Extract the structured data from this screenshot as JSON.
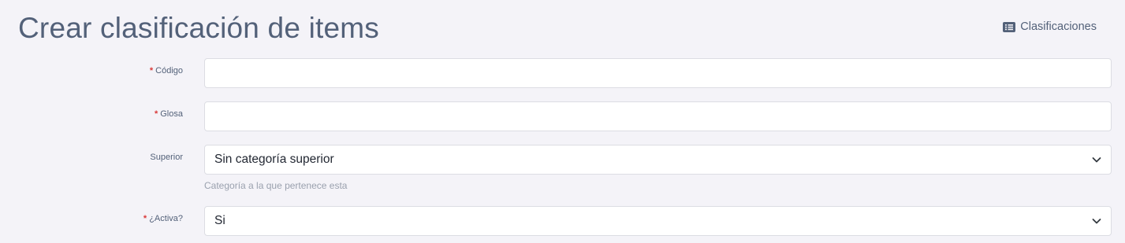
{
  "page": {
    "title": "Crear clasificación de items"
  },
  "header": {
    "link_label": "Clasificaciones",
    "link_icon": "list-icon"
  },
  "form": {
    "codigo": {
      "required_mark": "*",
      "label": "Código",
      "value": ""
    },
    "glosa": {
      "required_mark": "*",
      "label": "Glosa",
      "value": ""
    },
    "superior": {
      "label": "Superior",
      "selected": "Sin categoría superior",
      "help": "Categoría a la que pertenece esta"
    },
    "activa": {
      "required_mark": "*",
      "label": "¿Activa?",
      "selected": "Si"
    }
  },
  "colors": {
    "background": "#f4f3f8",
    "heading": "#536179",
    "required": "#d93a3a",
    "field_border": "#dcdde3",
    "help_text": "#9aa1ae"
  }
}
